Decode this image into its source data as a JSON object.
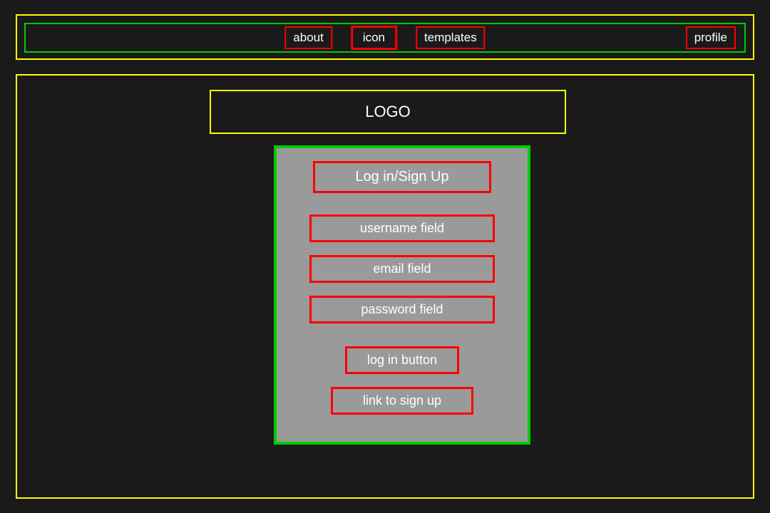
{
  "nav": {
    "about": "about",
    "icon": "icon",
    "templates": "templates",
    "profile": "profile"
  },
  "logo": "LOGO",
  "form": {
    "title": "Log in/Sign Up",
    "username": "username field",
    "email": "email field",
    "password": "password field",
    "login_button": "log in button",
    "signup_link": "link to sign up"
  }
}
